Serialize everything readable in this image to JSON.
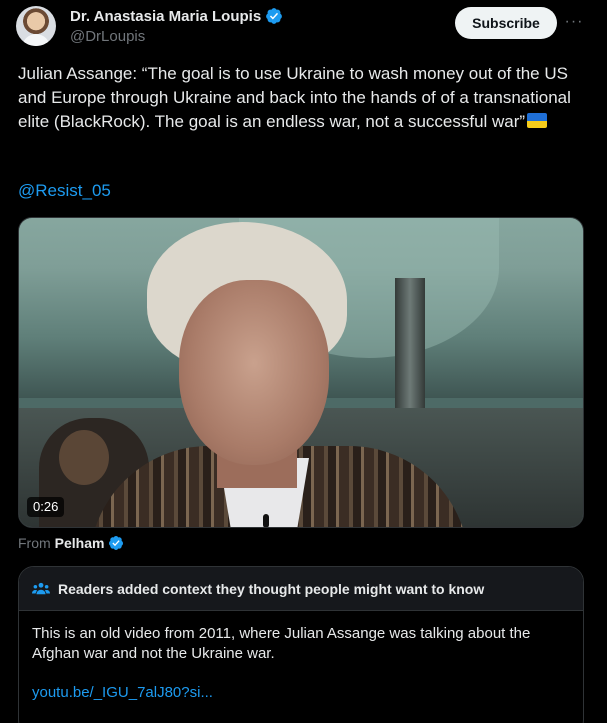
{
  "author": {
    "display_name": "Dr. Anastasia Maria Loupis",
    "handle": "@DrLoupis",
    "verified": true
  },
  "actions": {
    "subscribe_label": "Subscribe",
    "more_label": "···"
  },
  "tweet": {
    "text": "Julian Assange: “The goal is to use Ukraine to wash money out of the US and Europe through Ukraine and back into the hands of of a transnational elite (BlackRock). The goal is an endless war, not a successful war”",
    "mention": "@Resist_05",
    "flag_emoji": "ukraine-flag"
  },
  "media": {
    "duration": "0:26",
    "from_prefix": "From",
    "from_name": "Pelham",
    "from_verified": true
  },
  "community_note": {
    "title": "Readers added context they thought people might want to know",
    "body": "This is an old video from 2011, where Julian Assange was talking about the Afghan war and not the Ukraine war.",
    "link": "youtu.be/_IGU_7alJ80?si..."
  },
  "colors": {
    "background": "#000000",
    "text": "#e7e9ea",
    "muted": "#71767b",
    "link": "#1d9bf0",
    "verified_blue": "#1d9bf0",
    "border": "#2f3336"
  }
}
